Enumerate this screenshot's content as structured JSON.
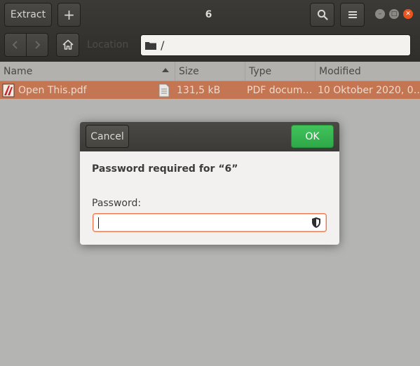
{
  "headerbar": {
    "extract_label": "Extract",
    "add_label": "+",
    "title": "6",
    "search_icon": "search-icon",
    "menu_icon": "hamburger-menu-icon",
    "window_controls": [
      "minimize",
      "maximize",
      "close"
    ]
  },
  "navbar": {
    "back_icon": "chevron-left-icon",
    "forward_icon": "chevron-right-icon",
    "home_icon": "home-icon",
    "ghost_label": "Location",
    "location": "/"
  },
  "columns": [
    "Name",
    "Size",
    "Type",
    "Modified"
  ],
  "files": [
    {
      "name": "Open This.pdf",
      "size": "131,5 kB",
      "type": "PDF docum…",
      "modified": "10 Oktober 2020, 0…"
    }
  ],
  "dialog": {
    "cancel_label": "Cancel",
    "ok_label": "OK",
    "title": "Password required for “6”",
    "field_label": "Password:",
    "field_value": "",
    "field_icon": "caps-lock-shield-icon"
  },
  "colors": {
    "accent_selection": "#c47552",
    "ok_green": "#36b24f",
    "close_orange": "#e9541f",
    "focus_border": "#e97a4f"
  }
}
